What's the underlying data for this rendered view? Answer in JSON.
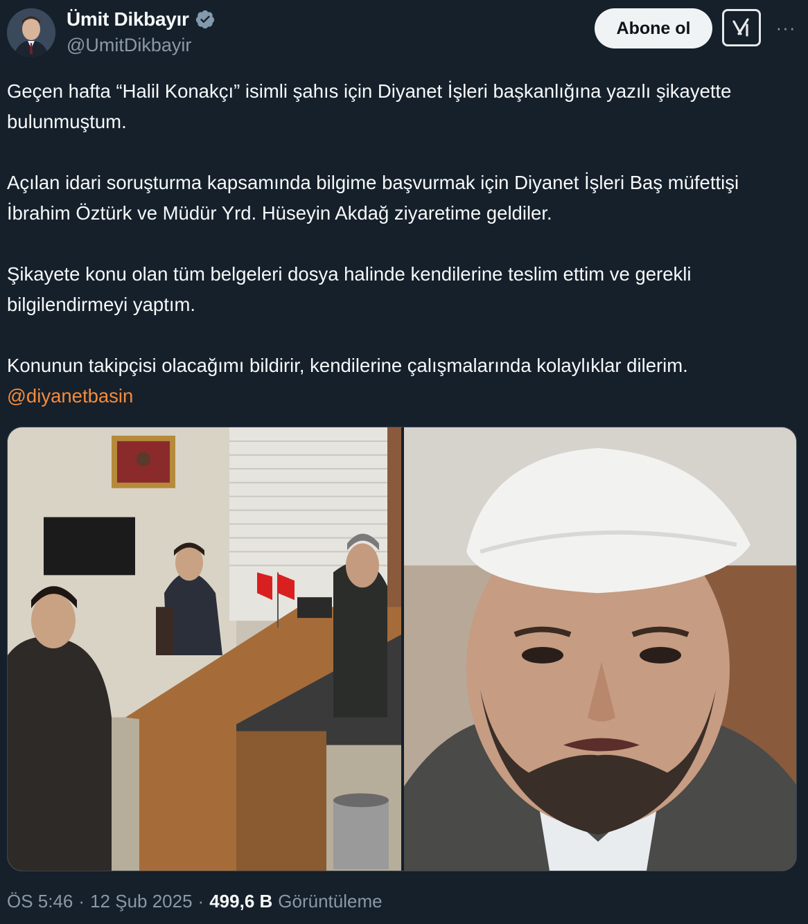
{
  "author": {
    "display_name": "Ümit Dikbayır",
    "handle": "@UmitDikbayir",
    "verified_icon": "verified-badge-icon",
    "avatar_icon": "profile-avatar"
  },
  "actions": {
    "follow_label": "Abone ol",
    "grok_icon": "grok-icon",
    "more_icon": "more-options-icon",
    "more_label": "···"
  },
  "tweet": {
    "paragraphs": [
      "Geçen hafta “Halil Konakçı” isimli şahıs  için Diyanet İşleri başkanlığına yazılı şikayette bulunmuştum.",
      "Açılan idari soruşturma kapsamında bilgime  başvurmak için Diyanet İşleri Baş müfettişi İbrahim Öztürk ve Müdür Yrd. Hüseyin Akdağ ziyaretime geldiler.",
      "Şikayete konu olan tüm belgeleri dosya halinde kendilerine teslim ettim ve gerekli bilgilendirmeyi yaptım."
    ],
    "last_line": "Konunun takipçisi olacağımı bildirir, kendilerine çalışmalarında kolaylıklar dilerim.",
    "mention": "@diyanetbasin"
  },
  "media": {
    "left_photo": "office-meeting-photo",
    "right_photo": "portrait-photo"
  },
  "meta": {
    "time": "ÖS 5:46",
    "separator": "·",
    "date": "12 Şub 2025",
    "views_count": "499,6 B",
    "views_label": "Görüntüleme"
  },
  "colors": {
    "background": "#15202b",
    "text": "#f7f9f9",
    "secondary": "#8b98a5",
    "mention": "#f58b3c",
    "verified": "#829aab"
  }
}
